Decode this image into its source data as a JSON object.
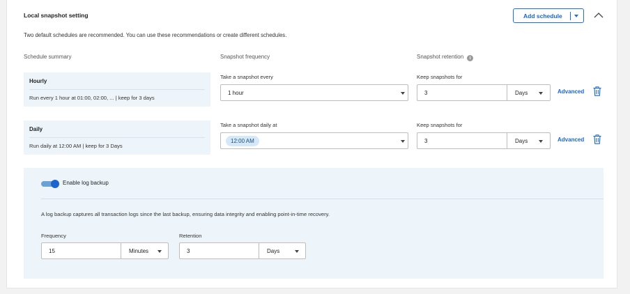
{
  "section": {
    "title": "Local snapshot setting",
    "add_schedule_label": "Add schedule",
    "description": "Two default schedules are recommended. You can use these recommendations or create different schedules."
  },
  "columns": {
    "summary": "Schedule summary",
    "frequency": "Snapshot frequency",
    "retention": "Snapshot retention"
  },
  "schedules": [
    {
      "name": "Hourly",
      "summary": "Run every 1 hour at 01:00, 02:00, ... | keep for 3 days",
      "frequency_label": "Take a snapshot every",
      "frequency_value": "1 hour",
      "retention_label": "Keep snapshots for",
      "retention_value": "3",
      "retention_unit": "Days",
      "advanced_label": "Advanced"
    },
    {
      "name": "Daily",
      "summary": "Run daily at 12:00 AM | keep for 3 Days",
      "frequency_label": "Take a snapshot daily at",
      "frequency_value": "12:00 AM",
      "retention_label": "Keep snapshots for",
      "retention_value": "3",
      "retention_unit": "Days",
      "advanced_label": "Advanced"
    }
  ],
  "log_backup": {
    "enabled": true,
    "label": "Enable log backup",
    "description": "A log backup captures all transaction logs since the last backup, ensuring data integrity and enabling point-in-time recovery.",
    "frequency_label": "Frequency",
    "frequency_value": "15",
    "frequency_unit": "Minutes",
    "retention_label": "Retention",
    "retention_value": "3",
    "retention_unit": "Days"
  },
  "colors": {
    "accent": "#1a66cc",
    "panel_bg": "#eef5fa",
    "chip_bg": "#d4e8f8"
  },
  "icons": {
    "info": "info-icon",
    "collapse": "chevron-up-icon",
    "delete": "trash-icon",
    "dropdown": "caret-down-icon"
  }
}
